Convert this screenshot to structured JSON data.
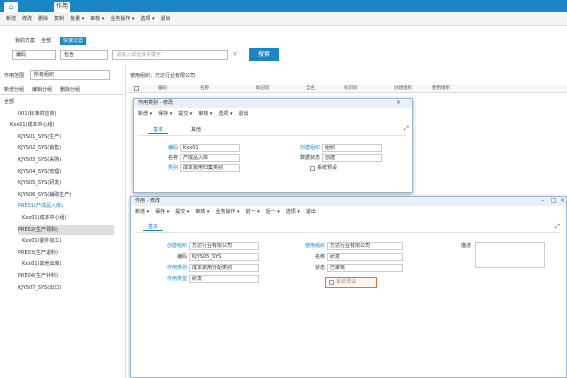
{
  "tabs": {
    "home": "⌂",
    "doc": "作用",
    "close": "×"
  },
  "toolbar": [
    "新增",
    "修改",
    "删除",
    "复制",
    "批量 ▾",
    "审核 ▾",
    "业务操作 ▾",
    "选项 ▾",
    "退出"
  ],
  "view_tabs": [
    "我的方案",
    "全部",
    "快速过滤"
  ],
  "filter": {
    "field": "编码",
    "op": "包含",
    "search_placeholder": "请输入或选择关键字",
    "clear": "×",
    "search_label": "搜索"
  },
  "left": {
    "select_label": "作用范围",
    "select_value": "所有组织",
    "links": [
      "新增分组",
      "编辑分组",
      "删除分组"
    ]
  },
  "tree": [
    "全部",
    "001(标准供应商)",
    "Kxx01(成本中心组)",
    "KJYS01_SYS(生产)",
    "KJYS02_SYS(销售)",
    "KJYS03_SYS(采购)",
    "KJYS04_SYS(管理)",
    "KJYS05_SYS(研发)",
    "KJYS06_SYS(辅助生产)",
    "PRE01(产成品入库)",
    "Kxx01(成本中心组)",
    "PRE02(生产领料)",
    "Kxx01(委外加工)",
    "PRE03(生产退料)",
    "Kxx01(其他出库)",
    "PRE04(生产补料)",
    "KJYS07_SYS(出口)"
  ],
  "grid": {
    "breadcrumb": "使用组织：万达行业有限公司",
    "headers": [
      "编码",
      "名称",
      "助记码",
      "全名",
      "标识码",
      "创建组织",
      "使用组织"
    ]
  },
  "dialog1": {
    "title": "作用类别 - 修改",
    "toolbar": [
      "新增 ▾",
      "保存 ▾",
      "提交 ▾",
      "审核 ▾",
      "选项 ▾",
      "退出"
    ],
    "tabs": [
      "基本",
      "其他"
    ],
    "code_label": "编码",
    "code": "Kxx01",
    "name_label": "名称",
    "name": "产成品入库",
    "type_label": "类别",
    "type": "成本费用归集类别",
    "org_label": "创建组织",
    "org": "组织",
    "status_label": "数据状态",
    "status": "创建",
    "check_label": "系统预设"
  },
  "dialog2": {
    "title": "作用 - 修改",
    "toolbar": [
      "新增 ▾",
      "保存 ▾",
      "提交 ▾",
      "审核 ▾",
      "业务操作 ▾",
      "前一 ▾",
      "后一 ▾",
      "选项 ▾",
      "退出"
    ],
    "tab": "基本",
    "org_label": "创建组织",
    "org": "万达行业有限公司",
    "code_label": "编码",
    "code": "KJYS05_SYS",
    "cat_label": "作用类别",
    "cat": "成本费用分配类别",
    "type_label": "作用类型",
    "type": "研发",
    "use_org_label": "使用组织",
    "use_org": "万达行业有限公司",
    "name_label": "名称",
    "name": "研发",
    "status_label": "状态",
    "status": "已审核",
    "desc_label": "描述",
    "check_label": "系统预设"
  },
  "colors": {
    "brand": "#1b86c7",
    "highlight": "#e8742c"
  }
}
